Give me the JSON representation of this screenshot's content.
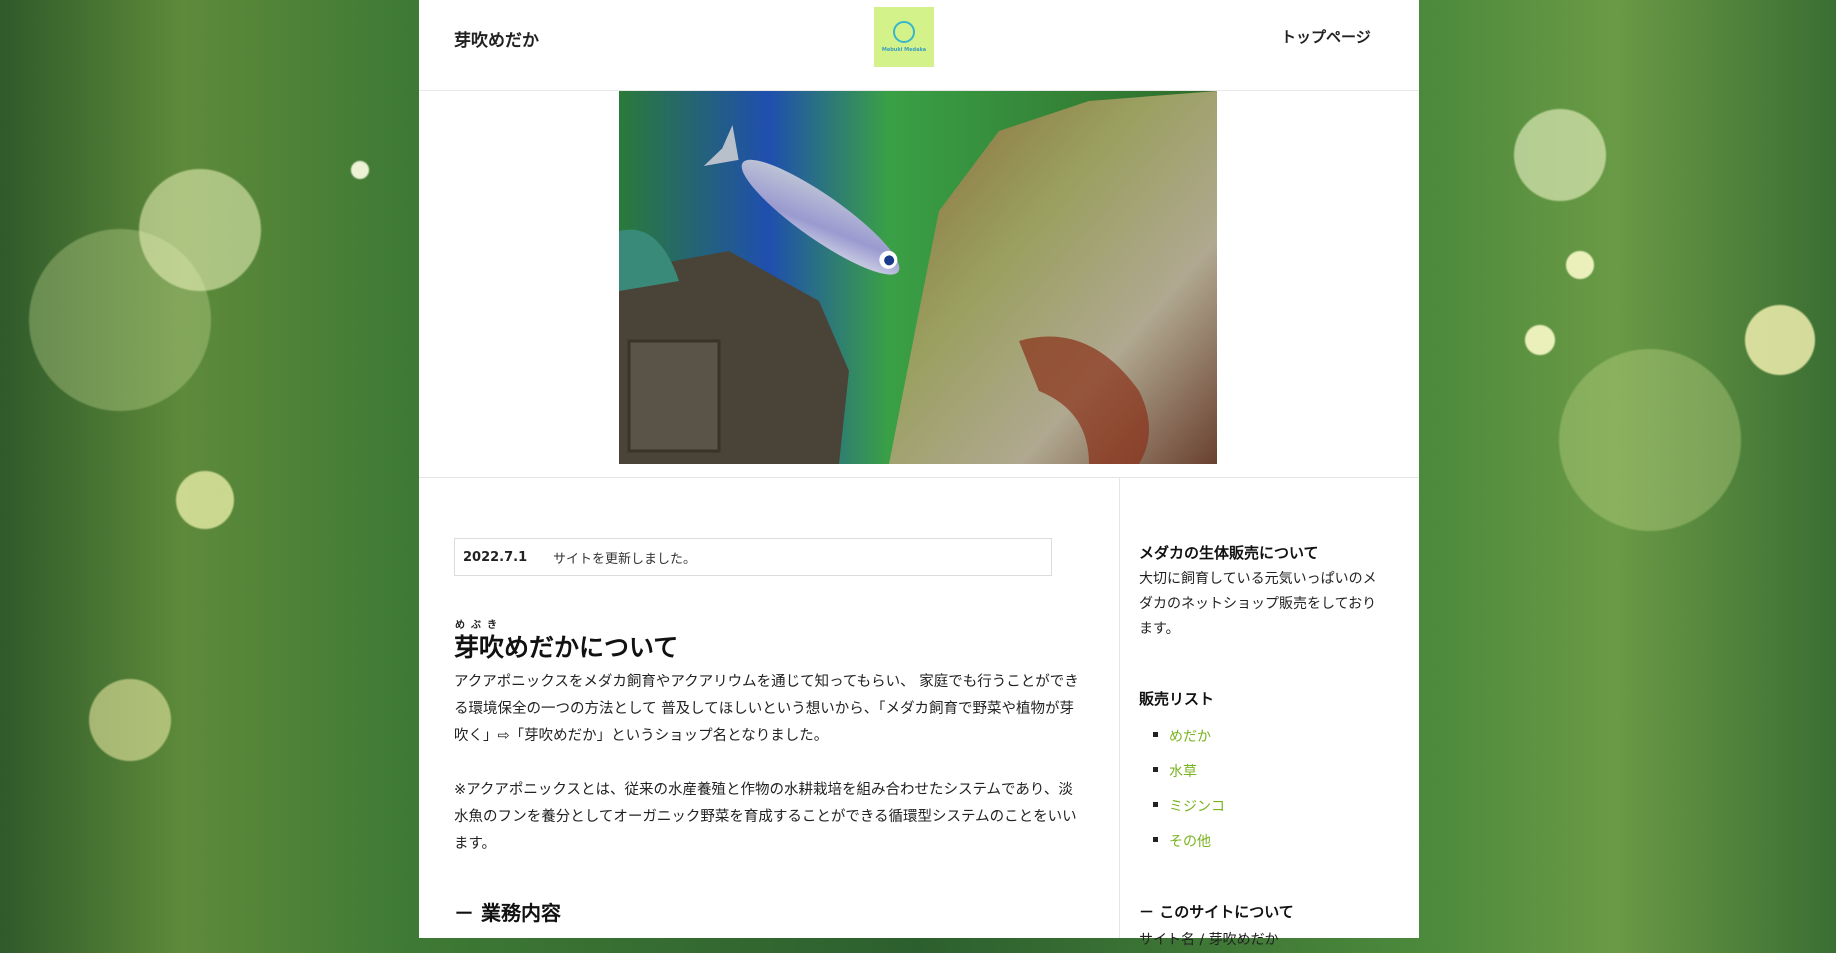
{
  "header": {
    "site_title": "芽吹めだか",
    "logo_text": "Mebuki Medaka",
    "nav_top": "トップページ"
  },
  "notice": {
    "date": "2022.7.1",
    "text": "サイトを更新しました。"
  },
  "main": {
    "ruby": "めぶき",
    "heading": "芽吹めだかについて",
    "paragraph1": "アクアポニックスをメダカ飼育やアクアリウムを通じて知ってもらい、 家庭でも行うことができる環境保全の一つの方法として 普及してほしいという想いから、「メダカ飼育で野菜や植物が芽吹く」⇨「芽吹めだか」というショップ名となりました。",
    "paragraph2": "※アクアポニックスとは、従来の水産養殖と作物の水耕栽培を組み合わせたシステムであり、淡水魚のフンを養分としてオーガニック野菜を育成することができる循環型システムのことをいいます。",
    "subheading": "－ 業務内容"
  },
  "sidebar": {
    "section1_title": "メダカの生体販売について",
    "section1_text": "大切に飼育している元気いっぱいのメダカのネットショップ販売をしております。",
    "section2_title": "販売リスト",
    "items": [
      "めだか",
      "水草",
      "ミジンコ",
      "その他"
    ],
    "section3_title": "－ このサイトについて",
    "section3_text": "サイト名 / 芽吹めだか"
  },
  "colors": {
    "link": "#7ab320",
    "logo_bg": "#d4f28a"
  }
}
